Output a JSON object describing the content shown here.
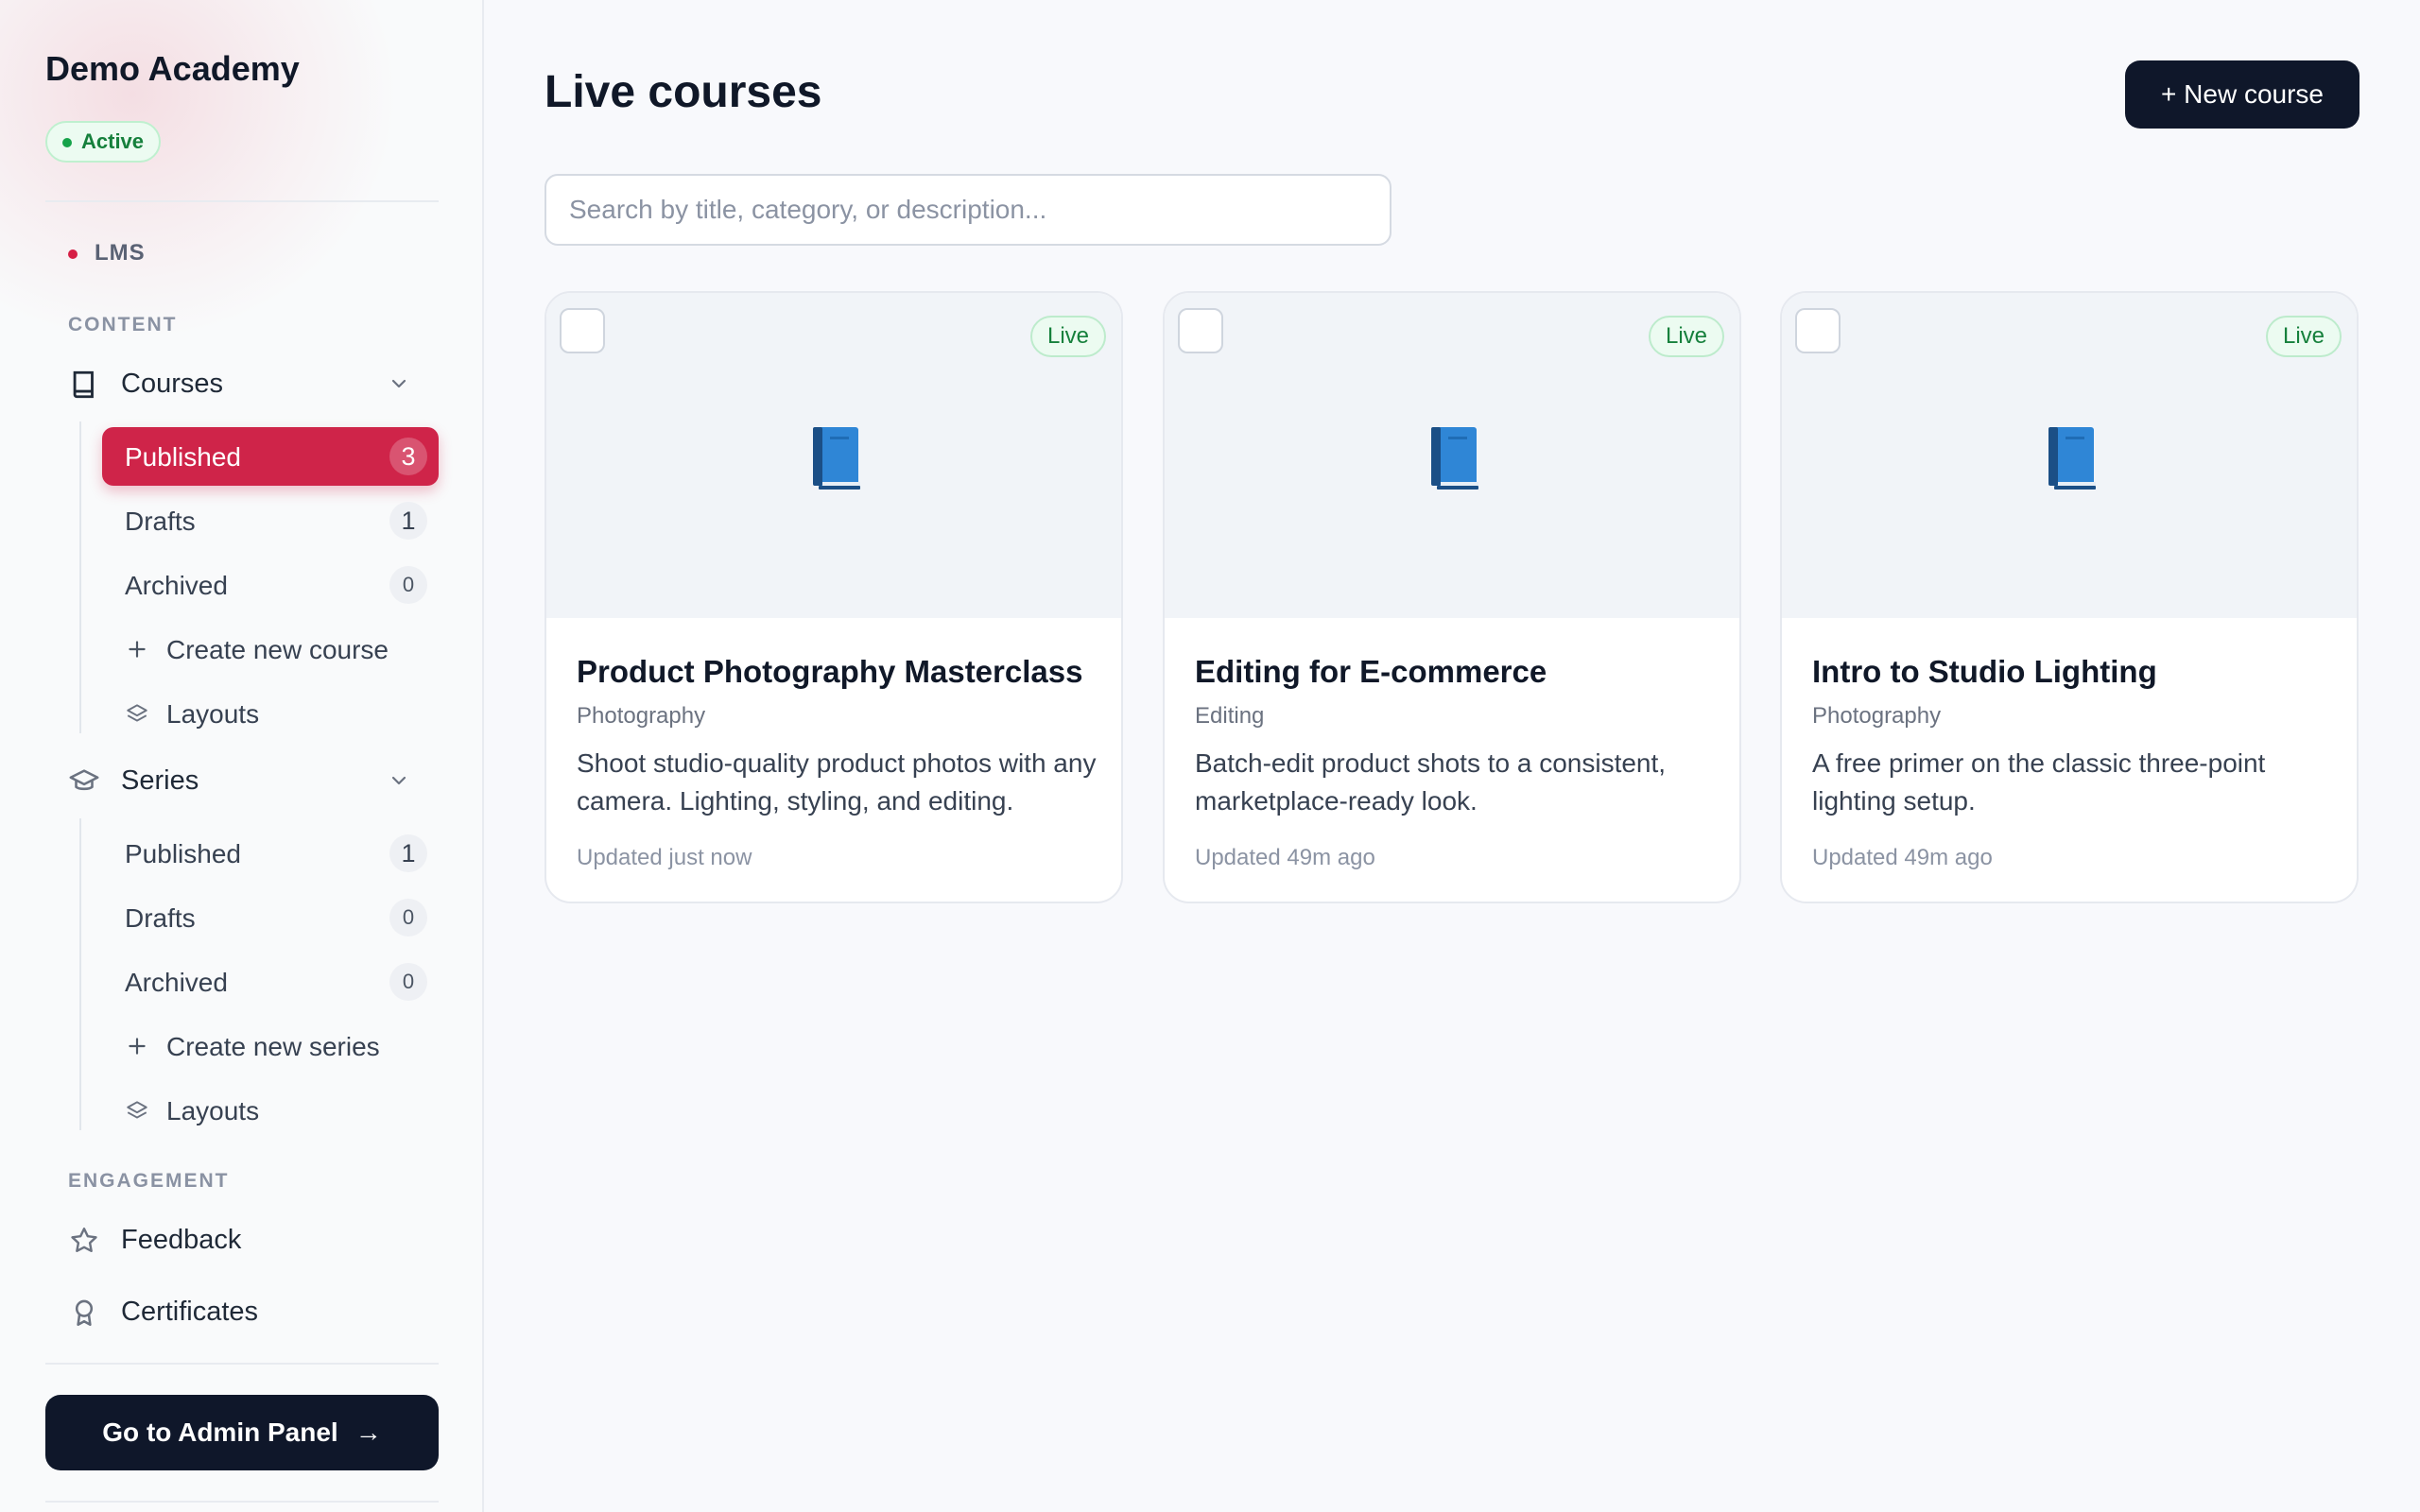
{
  "sidebar": {
    "brand": "Demo Academy",
    "status": "Active",
    "app_label": "LMS",
    "sections": {
      "content": "CONTENT",
      "engagement": "ENGAGEMENT"
    },
    "courses": {
      "label": "Courses",
      "items": [
        {
          "label": "Published",
          "count": "3"
        },
        {
          "label": "Drafts",
          "count": "1"
        },
        {
          "label": "Archived",
          "count": "0"
        },
        {
          "label": "Create new course"
        },
        {
          "label": "Layouts"
        }
      ]
    },
    "series": {
      "label": "Series",
      "items": [
        {
          "label": "Published",
          "count": "1"
        },
        {
          "label": "Drafts",
          "count": "0"
        },
        {
          "label": "Archived",
          "count": "0"
        },
        {
          "label": "Create new series"
        },
        {
          "label": "Layouts"
        }
      ]
    },
    "engagement_items": [
      {
        "label": "Feedback",
        "icon": "star-icon"
      },
      {
        "label": "Certificates",
        "icon": "award-icon"
      }
    ],
    "admin_button": "Go to Admin Panel",
    "admin_arrow": "→"
  },
  "main": {
    "title": "Live courses",
    "new_button": "+ New course",
    "search_placeholder": "Search by title, category, or description...",
    "cards": [
      {
        "badge": "Live",
        "title": "Product Photography Masterclass",
        "category": "Photography",
        "description": "Shoot studio-quality product photos with any camera. Lighting, styling, and editing.",
        "updated": "Updated just now"
      },
      {
        "badge": "Live",
        "title": "Editing for E-commerce",
        "category": "Editing",
        "description": "Batch-edit product shots to a consistent, marketplace-ready look.",
        "updated": "Updated 49m ago"
      },
      {
        "badge": "Live",
        "title": "Intro to Studio Lighting",
        "category": "Photography",
        "description": "A free primer on the classic three-point lighting setup.",
        "updated": "Updated 49m ago"
      }
    ]
  },
  "colors": {
    "accent": "#cf2449",
    "dark_button": "#0f172a",
    "success": "#16a34a"
  }
}
